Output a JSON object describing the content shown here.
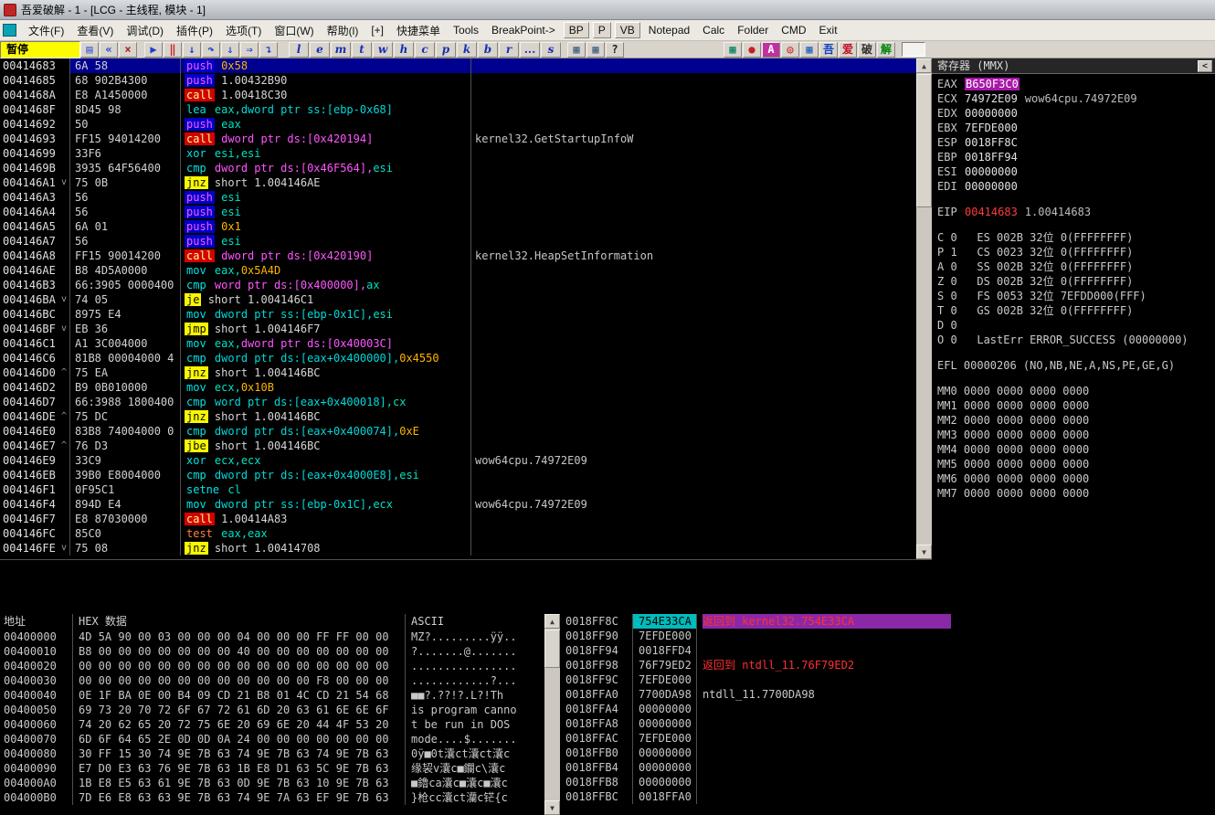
{
  "window": {
    "title": "吾爱破解 - 1 - [LCG -  主线程, 模块 - 1]"
  },
  "icons": {
    "scroll_up": "▲",
    "scroll_down": "▼"
  },
  "menu": {
    "items": [
      {
        "id": "file",
        "label": "文件(F)"
      },
      {
        "id": "view",
        "label": "查看(V)"
      },
      {
        "id": "debug",
        "label": "调试(D)"
      },
      {
        "id": "plugins",
        "label": "插件(P)"
      },
      {
        "id": "options",
        "label": "选项(T)"
      },
      {
        "id": "window",
        "label": "窗口(W)"
      },
      {
        "id": "help",
        "label": "帮助(l)"
      },
      {
        "id": "plus",
        "label": "[+]"
      },
      {
        "id": "quick-menu",
        "label": "快捷菜单"
      },
      {
        "id": "tools",
        "label": "Tools"
      },
      {
        "id": "breakpoint",
        "label": "BreakPoint->"
      },
      {
        "id": "bp",
        "label": "BP",
        "boxed": true
      },
      {
        "id": "p",
        "label": "P",
        "boxed": true
      },
      {
        "id": "vb",
        "label": "VB",
        "boxed": true
      },
      {
        "id": "notepad",
        "label": "Notepad"
      },
      {
        "id": "calc",
        "label": "Calc"
      },
      {
        "id": "folder",
        "label": "Folder"
      },
      {
        "id": "cmd",
        "label": "CMD"
      },
      {
        "id": "exit",
        "label": "Exit"
      }
    ]
  },
  "toolbar": {
    "status": "暂停",
    "icons_left": [
      {
        "name": "open-file-icon",
        "glyph": "▤",
        "color": "#3b5bd0"
      },
      {
        "name": "restart-icon",
        "glyph": "«",
        "color": "#1a3fd0"
      },
      {
        "name": "close-icon",
        "glyph": "×",
        "color": "#b02020"
      },
      {
        "sep": true
      },
      {
        "name": "run-icon",
        "glyph": "▶",
        "color": "#2040c8"
      },
      {
        "name": "pause-icon",
        "glyph": "‖",
        "color": "#c82020"
      },
      {
        "name": "step-into-icon",
        "glyph": "↓",
        "color": "#1a3fd0"
      },
      {
        "name": "step-over-icon",
        "glyph": "↷",
        "color": "#1a3fd0"
      },
      {
        "name": "trace-into-icon",
        "glyph": "⇓",
        "color": "#1a3fd0"
      },
      {
        "name": "trace-over-icon",
        "glyph": "⇒",
        "color": "#1a3fd0"
      },
      {
        "name": "execute-till-return-icon",
        "glyph": "↴",
        "color": "#1a3fd0"
      },
      {
        "sep": true
      }
    ],
    "letters": [
      "l",
      "e",
      "m",
      "t",
      "w",
      "h",
      "c",
      "p",
      "k",
      "b",
      "r",
      "...",
      "s"
    ],
    "icons_right": [
      {
        "name": "appearance-icon",
        "glyph": "▦",
        "color": "#406080"
      },
      {
        "name": "windows-icon",
        "glyph": "▦",
        "color": "#406080"
      },
      {
        "name": "help-icon",
        "glyph": "?",
        "color": "#202020"
      }
    ],
    "plugin_icons": [
      {
        "name": "plugin-grid-icon",
        "glyph": "▦",
        "color": "#008060"
      },
      {
        "name": "plugin-record-icon",
        "glyph": "●",
        "color": "#c82020"
      },
      {
        "name": "plugin-a-icon",
        "glyph": "A",
        "color": "#ffffff",
        "bg": "#c030a0"
      },
      {
        "name": "plugin-target-icon",
        "glyph": "◎",
        "color": "#c82020"
      },
      {
        "name": "plugin-table-icon",
        "glyph": "▦",
        "color": "#2060c0"
      },
      {
        "name": "lcg-wu-icon",
        "glyph": "吾",
        "color": "#1040c0"
      },
      {
        "name": "lcg-ai-icon",
        "glyph": "爱",
        "color": "#c01020"
      },
      {
        "name": "lcg-po-icon",
        "glyph": "破",
        "color": "#303030"
      },
      {
        "name": "lcg-jie-icon",
        "glyph": "解",
        "color": "#00860a"
      }
    ]
  },
  "disasm": {
    "rows": [
      {
        "a": "00414683",
        "d": "",
        "b": "6A 58",
        "m": "push",
        "t": "push",
        "o": [
          [
            "0x58",
            "imm"
          ]
        ],
        "c": "",
        "s": true
      },
      {
        "a": "00414685",
        "d": "",
        "b": "68 902B4300",
        "m": "push",
        "t": "push",
        "o": [
          [
            "1.00432B90",
            "addr"
          ]
        ],
        "c": ""
      },
      {
        "a": "0041468A",
        "d": "",
        "b": "E8 A1450000",
        "m": "call",
        "t": "call",
        "o": [
          [
            "1.00418C30",
            "addr"
          ]
        ],
        "c": ""
      },
      {
        "a": "0041468F",
        "d": "",
        "b": "8D45 98",
        "m": "lea",
        "t": "gen",
        "o": [
          [
            "eax,",
            "reg"
          ],
          [
            "dword ptr ss:[ebp-0x68]",
            "memr"
          ]
        ],
        "c": ""
      },
      {
        "a": "00414692",
        "d": "",
        "b": "50",
        "m": "push",
        "t": "push",
        "o": [
          [
            "eax",
            "reg"
          ]
        ],
        "c": ""
      },
      {
        "a": "00414693",
        "d": "",
        "b": "FF15 94014200",
        "m": "call",
        "t": "call",
        "o": [
          [
            "dword ptr ds:[0x420194]",
            "mem"
          ]
        ],
        "c": "kernel32.GetStartupInfoW"
      },
      {
        "a": "00414699",
        "d": "",
        "b": "33F6",
        "m": "xor",
        "t": "gen",
        "o": [
          [
            "esi,esi",
            "reg"
          ]
        ],
        "c": ""
      },
      {
        "a": "0041469B",
        "d": "",
        "b": "3935 64F56400",
        "m": "cmp",
        "t": "gen",
        "o": [
          [
            "dword ptr ds:[0x46F564],",
            "mem"
          ],
          [
            "esi",
            "reg"
          ]
        ],
        "c": ""
      },
      {
        "a": "004146A1",
        "d": "d",
        "b": "75 0B",
        "m": "jnz",
        "t": "jmp",
        "o": [
          [
            "short 1.004146AE",
            "addr"
          ]
        ],
        "c": ""
      },
      {
        "a": "004146A3",
        "d": "",
        "b": "56",
        "m": "push",
        "t": "push",
        "o": [
          [
            "esi",
            "reg"
          ]
        ],
        "c": ""
      },
      {
        "a": "004146A4",
        "d": "",
        "b": "56",
        "m": "push",
        "t": "push",
        "o": [
          [
            "esi",
            "reg"
          ]
        ],
        "c": ""
      },
      {
        "a": "004146A5",
        "d": "",
        "b": "6A 01",
        "m": "push",
        "t": "push",
        "o": [
          [
            "0x1",
            "imm"
          ]
        ],
        "c": ""
      },
      {
        "a": "004146A7",
        "d": "",
        "b": "56",
        "m": "push",
        "t": "push",
        "o": [
          [
            "esi",
            "reg"
          ]
        ],
        "c": ""
      },
      {
        "a": "004146A8",
        "d": "",
        "b": "FF15 90014200",
        "m": "call",
        "t": "call",
        "o": [
          [
            "dword ptr ds:[0x420190]",
            "mem"
          ]
        ],
        "c": "kernel32.HeapSetInformation"
      },
      {
        "a": "004146AE",
        "d": "",
        "b": "B8 4D5A0000",
        "m": "mov",
        "t": "gen",
        "o": [
          [
            "eax,",
            "reg"
          ],
          [
            "0x5A4D",
            "imm"
          ]
        ],
        "c": ""
      },
      {
        "a": "004146B3",
        "d": "",
        "b": "66:3905 0000400",
        "m": "cmp",
        "t": "gen",
        "o": [
          [
            "word ptr ds:[0x400000],",
            "mem"
          ],
          [
            "ax",
            "reg"
          ]
        ],
        "c": ""
      },
      {
        "a": "004146BA",
        "d": "d",
        "b": "74 05",
        "m": "je",
        "t": "jmp",
        "o": [
          [
            "short 1.004146C1",
            "addr"
          ]
        ],
        "c": ""
      },
      {
        "a": "004146BC",
        "d": "",
        "b": "8975 E4",
        "m": "mov",
        "t": "gen",
        "o": [
          [
            "dword ptr ss:[ebp-0x1C],",
            "memr"
          ],
          [
            "esi",
            "reg"
          ]
        ],
        "c": ""
      },
      {
        "a": "004146BF",
        "d": "d",
        "b": "EB 36",
        "m": "jmp",
        "t": "jmp",
        "o": [
          [
            "short 1.004146F7",
            "addr"
          ]
        ],
        "c": ""
      },
      {
        "a": "004146C1",
        "d": "",
        "b": "A1 3C004000",
        "m": "mov",
        "t": "gen",
        "o": [
          [
            "eax,",
            "reg"
          ],
          [
            "dword ptr ds:[0x40003C]",
            "mem"
          ]
        ],
        "c": ""
      },
      {
        "a": "004146C6",
        "d": "",
        "b": "81B8 00004000 4",
        "m": "cmp",
        "t": "gen",
        "o": [
          [
            "dword ptr ds:[eax+0x400000],",
            "memr"
          ],
          [
            "0x4550",
            "imm"
          ]
        ],
        "c": ""
      },
      {
        "a": "004146D0",
        "d": "u",
        "b": "75 EA",
        "m": "jnz",
        "t": "jmp",
        "o": [
          [
            "short 1.004146BC",
            "addr"
          ]
        ],
        "c": ""
      },
      {
        "a": "004146D2",
        "d": "",
        "b": "B9 0B010000",
        "m": "mov",
        "t": "gen",
        "o": [
          [
            "ecx,",
            "reg"
          ],
          [
            "0x10B",
            "imm"
          ]
        ],
        "c": ""
      },
      {
        "a": "004146D7",
        "d": "",
        "b": "66:3988 1800400",
        "m": "cmp",
        "t": "gen",
        "o": [
          [
            "word ptr ds:[eax+0x400018],",
            "memr"
          ],
          [
            "cx",
            "reg"
          ]
        ],
        "c": ""
      },
      {
        "a": "004146DE",
        "d": "u",
        "b": "75 DC",
        "m": "jnz",
        "t": "jmp",
        "o": [
          [
            "short 1.004146BC",
            "addr"
          ]
        ],
        "c": ""
      },
      {
        "a": "004146E0",
        "d": "",
        "b": "83B8 74004000 0",
        "m": "cmp",
        "t": "gen",
        "o": [
          [
            "dword ptr ds:[eax+0x400074],",
            "memr"
          ],
          [
            "0xE",
            "imm"
          ]
        ],
        "c": ""
      },
      {
        "a": "004146E7",
        "d": "u",
        "b": "76 D3",
        "m": "jbe",
        "t": "jmp",
        "o": [
          [
            "short 1.004146BC",
            "addr"
          ]
        ],
        "c": ""
      },
      {
        "a": "004146E9",
        "d": "",
        "b": "33C9",
        "m": "xor",
        "t": "gen",
        "o": [
          [
            "ecx,ecx",
            "reg"
          ]
        ],
        "c": "wow64cpu.74972E09"
      },
      {
        "a": "004146EB",
        "d": "",
        "b": "39B0 E8004000",
        "m": "cmp",
        "t": "gen",
        "o": [
          [
            "dword ptr ds:[eax+0x4000E8],",
            "memr"
          ],
          [
            "esi",
            "reg"
          ]
        ],
        "c": ""
      },
      {
        "a": "004146F1",
        "d": "",
        "b": "0F95C1",
        "m": "setne",
        "t": "gen",
        "o": [
          [
            "cl",
            "reg"
          ]
        ],
        "c": ""
      },
      {
        "a": "004146F4",
        "d": "",
        "b": "894D E4",
        "m": "mov",
        "t": "gen",
        "o": [
          [
            "dword ptr ss:[ebp-0x1C],",
            "memr"
          ],
          [
            "ecx",
            "reg"
          ]
        ],
        "c": "wow64cpu.74972E09"
      },
      {
        "a": "004146F7",
        "d": "",
        "b": "E8 87030000",
        "m": "call",
        "t": "call",
        "o": [
          [
            "1.00414A83",
            "addr"
          ]
        ],
        "c": ""
      },
      {
        "a": "004146FC",
        "d": "",
        "b": "85C0",
        "m": "test",
        "t": "test",
        "o": [
          [
            "eax,eax",
            "reg"
          ]
        ],
        "c": ""
      },
      {
        "a": "004146FE",
        "d": "d",
        "b": "75 08",
        "m": "jnz",
        "t": "jmp",
        "o": [
          [
            "short 1.00414708",
            "addr"
          ]
        ],
        "c": ""
      }
    ]
  },
  "registers": {
    "title": "寄存器 (MMX)",
    "collapse": "<",
    "gpr": [
      {
        "name": "EAX",
        "value": "B650F3C0",
        "comment": "",
        "hl": true
      },
      {
        "name": "ECX",
        "value": "74972E09",
        "comment": "wow64cpu.74972E09",
        "hl": false
      },
      {
        "name": "EDX",
        "value": "00000000",
        "comment": "",
        "hl": false
      },
      {
        "name": "EBX",
        "value": "7EFDE000",
        "comment": "",
        "hl": false
      },
      {
        "name": "ESP",
        "value": "0018FF8C",
        "comment": "",
        "hl": false
      },
      {
        "name": "EBP",
        "value": "0018FF94",
        "comment": "",
        "hl": false
      },
      {
        "name": "ESI",
        "value": "00000000",
        "comment": "",
        "hl": false
      },
      {
        "name": "EDI",
        "value": "00000000",
        "comment": "",
        "hl": false
      }
    ],
    "eip": {
      "name": "EIP",
      "value": "00414683",
      "comment": "1.00414683"
    },
    "flag_rows": [
      "C 0   ES 002B 32位 0(FFFFFFFF)",
      "P 1   CS 0023 32位 0(FFFFFFFF)",
      "A 0   SS 002B 32位 0(FFFFFFFF)",
      "Z 0   DS 002B 32位 0(FFFFFFFF)",
      "S 0   FS 0053 32位 7EFDD000(FFF)",
      "T 0   GS 002B 32位 0(FFFFFFFF)",
      "D 0",
      "O 0   LastErr ERROR_SUCCESS (00000000)"
    ],
    "efl": "EFL 00000206 (NO,NB,NE,A,NS,PE,GE,G)",
    "mmx": [
      "MM0 0000 0000 0000 0000",
      "MM1 0000 0000 0000 0000",
      "MM2 0000 0000 0000 0000",
      "MM3 0000 0000 0000 0000",
      "MM4 0000 0000 0000 0000",
      "MM5 0000 0000 0000 0000",
      "MM6 0000 0000 0000 0000",
      "MM7 0000 0000 0000 0000"
    ]
  },
  "dump": {
    "headers": [
      "地址",
      "HEX 数据",
      "ASCII"
    ],
    "rows": [
      {
        "a": "00400000",
        "h": "4D 5A 90 00 03 00 00 00 04 00 00 00 FF FF 00 00",
        "s": "MZ?.........ÿÿ.."
      },
      {
        "a": "00400010",
        "h": "B8 00 00 00 00 00 00 00 40 00 00 00 00 00 00 00",
        "s": "?.......@......."
      },
      {
        "a": "00400020",
        "h": "00 00 00 00 00 00 00 00 00 00 00 00 00 00 00 00",
        "s": "................"
      },
      {
        "a": "00400030",
        "h": "00 00 00 00 00 00 00 00 00 00 00 00 F8 00 00 00",
        "s": "............?..."
      },
      {
        "a": "00400040",
        "h": "0E 1F BA 0E 00 B4 09 CD 21 B8 01 4C CD 21 54 68",
        "s": "■■?.??!?.L?!Th"
      },
      {
        "a": "00400050",
        "h": "69 73 20 70 72 6F 67 72 61 6D 20 63 61 6E 6E 6F",
        "s": "is program canno"
      },
      {
        "a": "00400060",
        "h": "74 20 62 65 20 72 75 6E 20 69 6E 20 44 4F 53 20",
        "s": "t be run in DOS "
      },
      {
        "a": "00400070",
        "h": "6D 6F 64 65 2E 0D 0D 0A 24 00 00 00 00 00 00 00",
        "s": "mode....$......."
      },
      {
        "a": "00400080",
        "h": "30 FF 15 30 74 9E 7B 63 74 9E 7B 63 74 9E 7B 63",
        "s": "0ÿ■0t灢ct灢ct灢c"
      },
      {
        "a": "00400090",
        "h": "E7 D0 E3 63 76 9E 7B 63 1B E8 D1 63 5C 9E 7B 63",
        "s": "缘袃v灢c■鑭c\\灢c"
      },
      {
        "a": "004000A0",
        "h": "1B E8 E5 63 61 9E 7B 63 0D 9E 7B 63 10 9E 7B 63",
        "s": "■鑥ca灢c■灢c■灢c"
      },
      {
        "a": "004000B0",
        "h": "7D E6 E8 63 63 9E 7B 63 74 9E 7A 63 EF 9E 7B 63",
        "s": "}枪cc灢ct灡c铓{c"
      }
    ]
  },
  "stack": {
    "rows": [
      {
        "a": "0018FF8C",
        "v": "754E33CA",
        "c": "返回到 kernel32.754E33CA",
        "st": "top"
      },
      {
        "a": "0018FF90",
        "v": "7EFDE000",
        "c": "",
        "st": ""
      },
      {
        "a": "0018FF94",
        "v": "0018FFD4",
        "c": "",
        "st": ""
      },
      {
        "a": "0018FF98",
        "v": "76F79ED2",
        "c": "返回到 ntdll_11.76F79ED2",
        "st": "ret"
      },
      {
        "a": "0018FF9C",
        "v": "7EFDE000",
        "c": "",
        "st": ""
      },
      {
        "a": "0018FFA0",
        "v": "7700DA98",
        "c": "ntdll_11.7700DA98",
        "st": ""
      },
      {
        "a": "0018FFA4",
        "v": "00000000",
        "c": "",
        "st": ""
      },
      {
        "a": "0018FFA8",
        "v": "00000000",
        "c": "",
        "st": ""
      },
      {
        "a": "0018FFAC",
        "v": "7EFDE000",
        "c": "",
        "st": ""
      },
      {
        "a": "0018FFB0",
        "v": "00000000",
        "c": "",
        "st": ""
      },
      {
        "a": "0018FFB4",
        "v": "00000000",
        "c": "",
        "st": ""
      },
      {
        "a": "0018FFB8",
        "v": "00000000",
        "c": "",
        "st": ""
      },
      {
        "a": "0018FFBC",
        "v": "0018FFA0",
        "c": "",
        "st": ""
      }
    ]
  }
}
